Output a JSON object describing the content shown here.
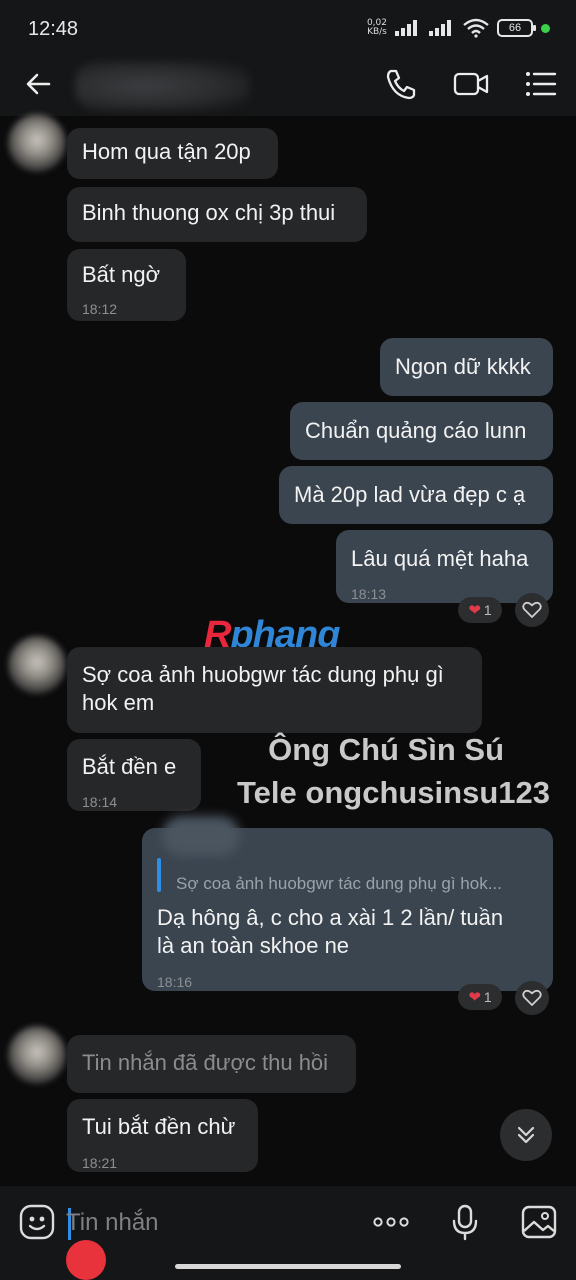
{
  "status_bar": {
    "time": "12:48",
    "net_speed_value": "0,02",
    "net_speed_unit": "KB/s",
    "battery": "66"
  },
  "header": {
    "back_icon": "arrow-left-icon",
    "call_icon": "phone-icon",
    "video_icon": "video-camera-icon",
    "menu_icon": "list-menu-icon"
  },
  "messages": [
    {
      "text": "Hom qua tận 20p"
    },
    {
      "text": "Binh thuong ox chị 3p thui"
    },
    {
      "text": "Bất ngờ",
      "time": "18:12"
    },
    {
      "text": "Ngon dữ kkkk"
    },
    {
      "text": "Chuẩn quảng cáo lunn"
    },
    {
      "text": "Mà 20p lad vừa đẹp c ạ"
    },
    {
      "text": "Lâu quá mệt haha",
      "time": "18:13",
      "reaction_count": "1"
    },
    {
      "text_line1": "Sợ coa ảnh huobgwr tác dung phụ gì",
      "text_line2": "hok em"
    },
    {
      "text": "Bắt đền e",
      "time": "18:14"
    },
    {
      "quote": "Sợ coa ảnh huobgwr tác dung phụ gì hok...",
      "text_line1": "Dạ hông â, c cho a xài 1 2 lần/ tuần",
      "text_line2": "là an toàn skhoe ne",
      "time": "18:16",
      "reaction_count": "1"
    },
    {
      "text": "Tin nhắn đã được thu hồi"
    },
    {
      "text": "Tui bắt đền chừ",
      "time": "18:21"
    }
  ],
  "overlay": {
    "watermark_first": "R",
    "watermark_rest": "phang",
    "line1": "Ông Chú Sìn Sú",
    "line2": "Tele ongchusinsu123"
  },
  "input": {
    "placeholder": "Tin nhắn",
    "emoji_icon": "sticker-face-icon",
    "more_icon": "more-dots-icon",
    "mic_icon": "microphone-icon",
    "image_icon": "image-gallery-icon"
  },
  "colors": {
    "received_bubble": "#262729",
    "sent_bubble": "#3a4550",
    "accent": "#2e8ee8",
    "heart": "#e2394b"
  }
}
